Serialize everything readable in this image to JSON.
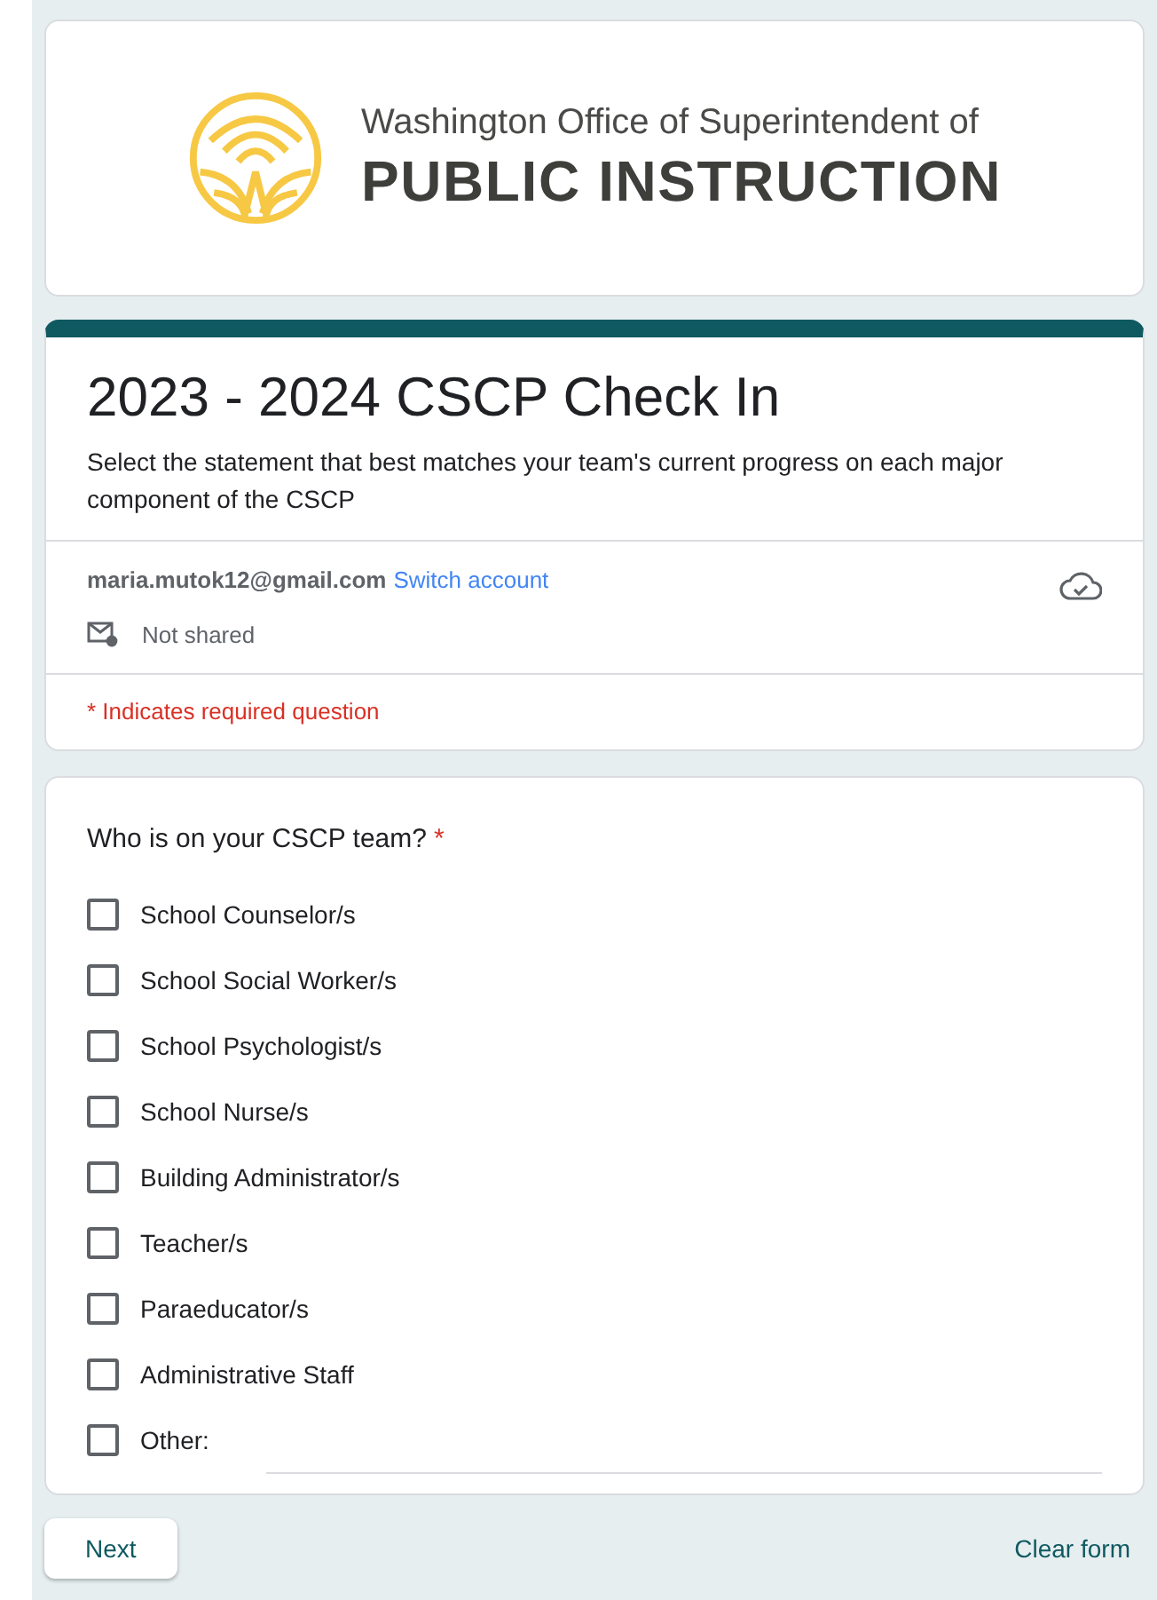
{
  "header": {
    "logo_line1": "Washington Office of Superintendent of",
    "logo_line2": "PUBLIC INSTRUCTION"
  },
  "form": {
    "title": "2023 - 2024 CSCP Check In",
    "description": "Select the statement that best matches your team's current progress on each major component of the CSCP",
    "account": "maria.mutok12@gmail.com",
    "switch_account": "Switch account",
    "sharing": "Not shared",
    "required_note": "* Indicates required question"
  },
  "question": {
    "text": "Who is on your CSCP team?",
    "required_mark": "*",
    "options": [
      {
        "label": "School Counselor/s",
        "checked": false,
        "kind": "checkbox"
      },
      {
        "label": "School Social Worker/s",
        "checked": false,
        "kind": "checkbox"
      },
      {
        "label": "School Psychologist/s",
        "checked": false,
        "kind": "checkbox"
      },
      {
        "label": "School Nurse/s",
        "checked": false,
        "kind": "checkbox"
      },
      {
        "label": "Building Administrator/s",
        "checked": false,
        "kind": "checkbox"
      },
      {
        "label": "Teacher/s",
        "checked": false,
        "kind": "checkbox"
      },
      {
        "label": "Paraeducator/s",
        "checked": false,
        "kind": "checkbox"
      },
      {
        "label": "Administrative Staff",
        "checked": false,
        "kind": "checkbox"
      },
      {
        "label": "Other:",
        "checked": false,
        "kind": "other"
      }
    ]
  },
  "footer": {
    "next": "Next",
    "clear": "Clear form"
  }
}
